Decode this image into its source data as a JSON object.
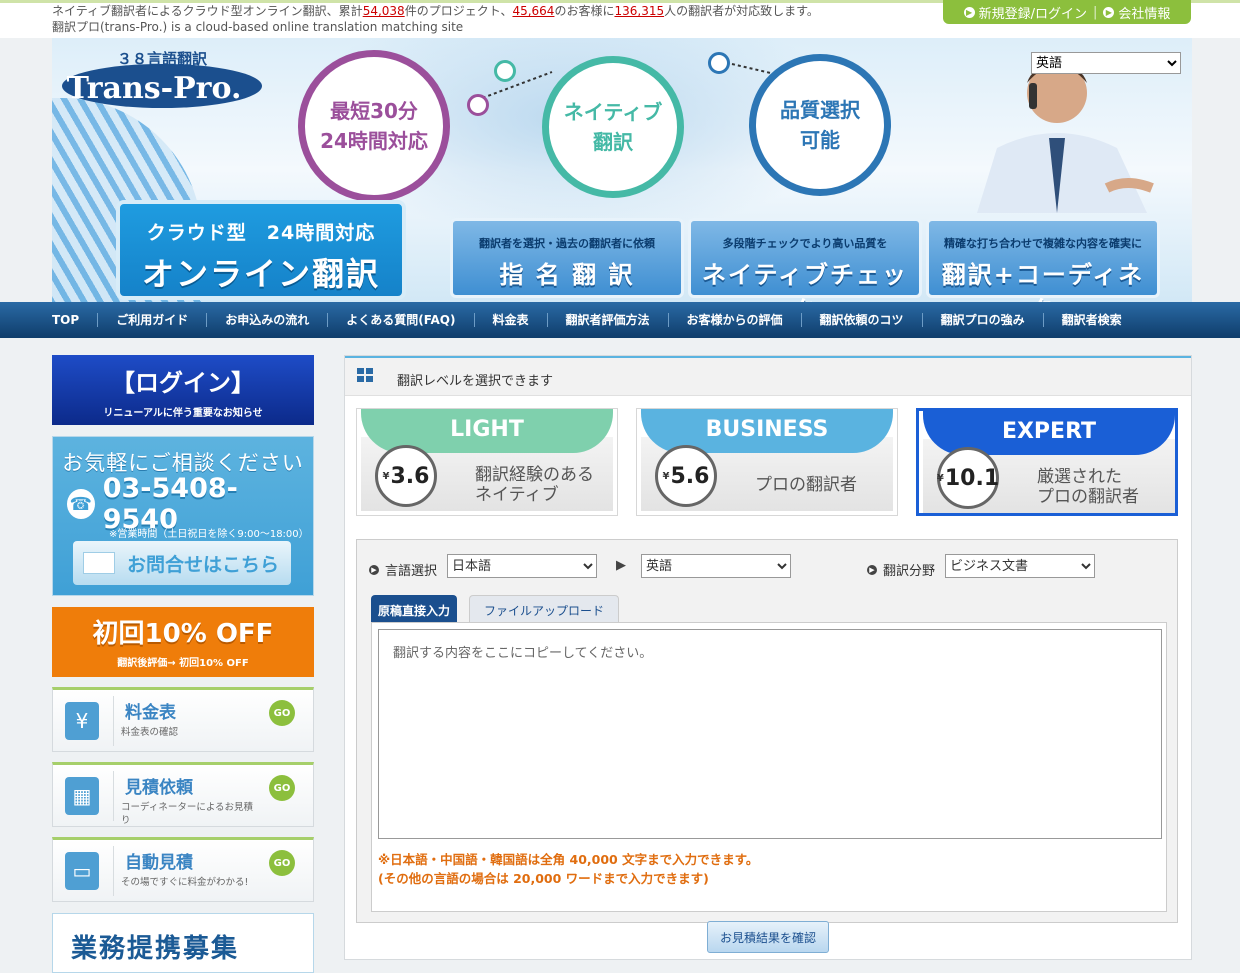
{
  "top": {
    "line1_prefix": "ネイティブ翻訳者によるクラウド型オンライン翻訳、累計",
    "projects": "54,038",
    "line1_mid1": "件のプロジェクト、",
    "customers": "45,664",
    "line1_mid2": "のお客様に",
    "translators": "136,315",
    "line1_suffix": "人の翻訳者が対応致します。",
    "line2": "翻訳プロ(trans-Pro.) is a cloud-based online translation matching site",
    "register_label": "新規登録/ログイン",
    "company_label": "会社情報"
  },
  "header": {
    "logo_top": "３８言語翻訳",
    "logo_main": "Trans-Pro.",
    "circle1_l1": "最短30分",
    "circle1_l2": "24時間対応",
    "circle2_l1": "ネイティブ",
    "circle2_l2": "翻訳",
    "circle3_l1": "品質選択",
    "circle3_l2": "可能",
    "lang_selected": "英語",
    "cloud_l1": "クラウド型　24時間対応",
    "cloud_l2": "オンライン翻訳",
    "feature1_sub": "翻訳者を選択・過去の翻訳者に依頼",
    "feature1_main": "指 名 翻 訳",
    "feature2_sub": "多段階チェックでより高い品質を",
    "feature2_main": "ネイティブチェック",
    "feature3_sub": "精確な打ち合わせで複雑な内容を確実に",
    "feature3_main": "翻訳+コーディネーター"
  },
  "nav": [
    "TOP",
    "ご利用ガイド",
    "お申込みの流れ",
    "よくある質問(FAQ)",
    "料金表",
    "翻訳者評価方法",
    "お客様からの評価",
    "翻訳依頼のコツ",
    "翻訳プロの強み",
    "翻訳者検索"
  ],
  "sidebar": {
    "login_title": "【ログイン】",
    "login_sub": "リニューアルに伴う重要なお知らせ",
    "contact_title": "お気軽にご相談ください",
    "phone": "03-5408-9540",
    "hours": "※営業時間（土日祝日を除く9:00～18:00）",
    "mail_label": "お問合せはこちら",
    "promo_title": "初回10% OFF",
    "promo_sub": "翻訳後評価→ 初回10% OFF",
    "cards": [
      {
        "title": "料金表",
        "sub": "料金表の確認",
        "go": "GO"
      },
      {
        "title": "見積依頼",
        "sub": "コーディネーターによるお見積り",
        "go": "GO"
      },
      {
        "title": "自動見積",
        "sub": "その場ですぐに料金がわかる!",
        "go": "GO"
      }
    ],
    "partner_title": "業務提携募集"
  },
  "main": {
    "heading": "翻訳レベルを選択できます",
    "levels": [
      {
        "name": "LIGHT",
        "price": "3.6",
        "yen": "¥",
        "desc1": "翻訳経験のある",
        "desc2": "ネイティブ",
        "color": "#7fd0ad"
      },
      {
        "name": "BUSINESS",
        "price": "5.6",
        "yen": "¥",
        "desc1": "",
        "desc2": "プロの翻訳者",
        "color": "#5ab3e0"
      },
      {
        "name": "EXPERT",
        "price": "10.1",
        "yen": "¥",
        "desc1": "厳選された",
        "desc2": "プロの翻訳者",
        "color": "#1a5fd6"
      }
    ],
    "form": {
      "lang_label": "言語選択",
      "source_lang": "日本語",
      "target_lang": "英語",
      "field_label": "翻訳分野",
      "field_value": "ビジネス文書",
      "tab_direct": "原稿直接入力",
      "tab_upload": "ファイルアップロード",
      "textarea_placeholder": "翻訳する内容をここにコピーしてください。",
      "note1": "※日本語・中国語・韓国語は全角 40,000 文字まで入力できます。",
      "note2": "(その他の言語の場合は 20,000 ワードまで入力できます)"
    },
    "submit_label": "お見積結果を確認"
  }
}
